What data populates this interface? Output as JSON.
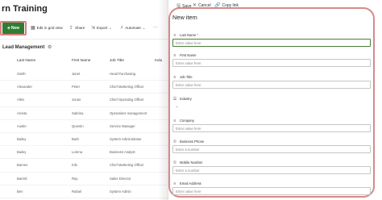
{
  "page": {
    "title": "rn Training"
  },
  "commandbar": {
    "new_label": "New",
    "edit_grid_label": "Edit in grid view",
    "share_label": "Share",
    "export_label": "Export",
    "automate_label": "Automate"
  },
  "list": {
    "title": "Lead Management",
    "columns": [
      "Last Name",
      "First Name",
      "Job Title",
      "Indu"
    ],
    "rows": [
      [
        "Smith",
        "Janet",
        "Head Purchasing"
      ],
      [
        "Alexander",
        "Peter",
        "Chief Marketing Officer"
      ],
      [
        "Allen",
        "Jonas",
        "Chief Operating Officer"
      ],
      [
        "Arrieta",
        "Sabrina",
        "Operations management"
      ],
      [
        "Austin",
        "Quentin",
        "Service Manager"
      ],
      [
        "Bailey",
        "Barb",
        "System Administrator"
      ],
      [
        "Bailey",
        "Lorena",
        "Business Analyst"
      ],
      [
        "Barnes",
        "Kilo",
        "Chief Marketing Officer"
      ],
      [
        "Barrett",
        "Ray",
        "Sales Director"
      ],
      [
        "Ben",
        "Rafael",
        "System Admin"
      ]
    ]
  },
  "panel": {
    "save_label": "Save",
    "cancel_label": "Cancel",
    "copy_link_label": "Copy link",
    "title": "New item",
    "fields": [
      {
        "label": "Last Name",
        "required": "*",
        "placeholder": "Enter value here",
        "icon": "text-field-icon"
      },
      {
        "label": "First Name",
        "placeholder": "Enter value here",
        "icon": "text-field-icon"
      },
      {
        "label": "Job Title",
        "placeholder": "Enter value here",
        "icon": "text-field-icon"
      },
      {
        "label": "Industry",
        "value": "--",
        "icon": "choice-field-icon"
      },
      {
        "label": "Company",
        "placeholder": "Enter value here",
        "icon": "text-field-icon"
      },
      {
        "label": "Business Phone",
        "placeholder": "Enter a number",
        "icon": "number-field-icon"
      },
      {
        "label": "Mobile Number",
        "placeholder": "Enter a number",
        "icon": "number-field-icon"
      },
      {
        "label": "Email Address",
        "placeholder": "Enter value here",
        "icon": "text-field-icon"
      }
    ]
  },
  "colors": {
    "accent_green": "#2f7d32",
    "highlight_frame": "#d88989"
  }
}
